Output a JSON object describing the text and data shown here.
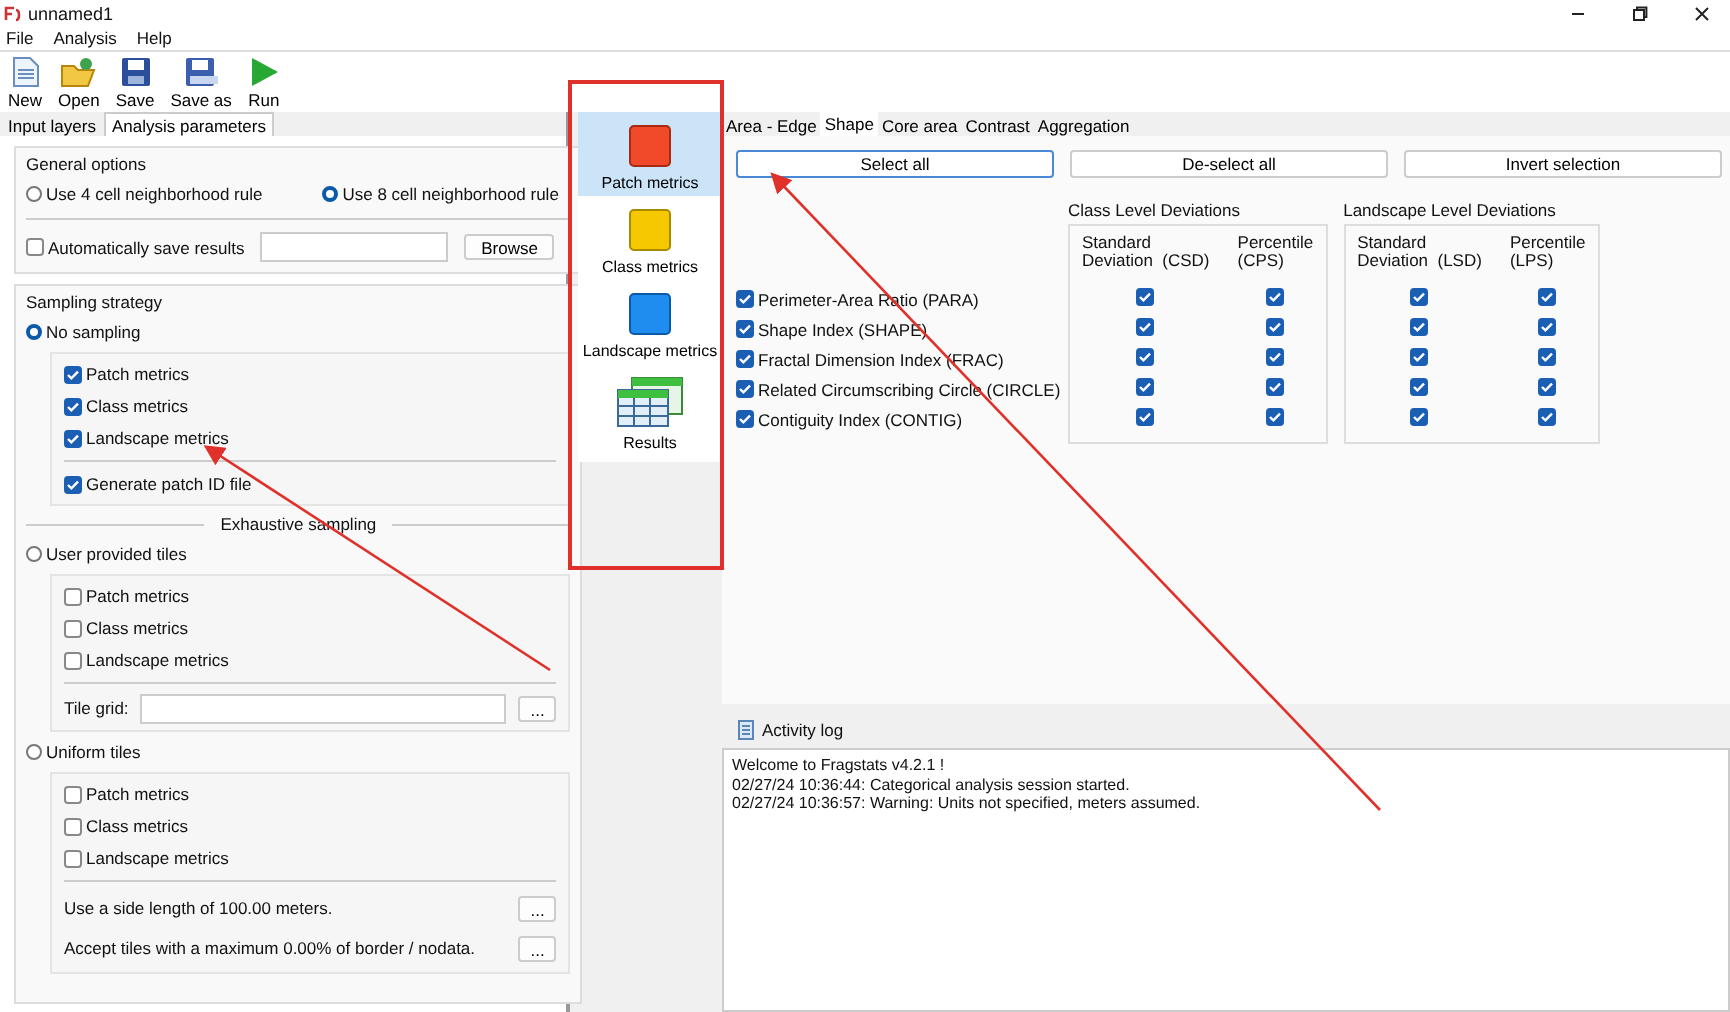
{
  "window": {
    "title": "unnamed1"
  },
  "menu": [
    "File",
    "Analysis",
    "Help"
  ],
  "toolbar": [
    {
      "label": "New",
      "kind": "new"
    },
    {
      "label": "Open",
      "kind": "open"
    },
    {
      "label": "Save",
      "kind": "save"
    },
    {
      "label": "Save as",
      "kind": "saveas"
    },
    {
      "label": "Run",
      "kind": "run"
    }
  ],
  "left_tabs": [
    {
      "label": "Input layers",
      "selected": false
    },
    {
      "label": "Analysis parameters",
      "selected": true
    }
  ],
  "general_options": {
    "title": "General options",
    "neighborhood": [
      {
        "label": "Use 4 cell neighborhood rule",
        "selected": false
      },
      {
        "label": "Use 8 cell neighborhood rule",
        "selected": true
      }
    ],
    "auto_save": {
      "label": "Automatically save results",
      "checked": false
    },
    "browse_button": "Browse"
  },
  "sampling": {
    "title": "Sampling strategy",
    "no_sampling": {
      "label": "No sampling",
      "selected": true,
      "metrics": [
        {
          "label": "Patch metrics",
          "checked": true
        },
        {
          "label": "Class metrics",
          "checked": true
        },
        {
          "label": "Landscape metrics",
          "checked": true
        }
      ],
      "patch_id": {
        "label": "Generate patch ID file",
        "checked": true
      }
    },
    "exhaustive_label": "Exhaustive sampling",
    "user_tiles": {
      "label": "User provided tiles",
      "selected": false,
      "metrics": [
        {
          "label": "Patch metrics",
          "checked": false
        },
        {
          "label": "Class metrics",
          "checked": false
        },
        {
          "label": "Landscape metrics",
          "checked": false
        }
      ],
      "tile_grid_label": "Tile grid:",
      "button": "..."
    },
    "uniform_tiles": {
      "label": "Uniform tiles",
      "selected": false,
      "metrics": [
        {
          "label": "Patch metrics",
          "checked": false
        },
        {
          "label": "Class metrics",
          "checked": false
        },
        {
          "label": "Landscape metrics",
          "checked": false
        }
      ],
      "settings": [
        {
          "text": "Use a side length of 100.00 meters.",
          "button": "..."
        },
        {
          "text": "Accept tiles with a maximum 0.00% of border / nodata.",
          "button": "..."
        }
      ]
    }
  },
  "metric_groups": [
    {
      "label": "Patch metrics",
      "kind": "patch",
      "selected": true
    },
    {
      "label": "Class metrics",
      "kind": "class",
      "selected": false
    },
    {
      "label": "Landscape metrics",
      "kind": "landscape",
      "selected": false
    },
    {
      "label": "Results",
      "kind": "results",
      "selected": false
    }
  ],
  "metric_tabs": [
    {
      "label": "Area - Edge",
      "selected": false
    },
    {
      "label": "Shape",
      "selected": true
    },
    {
      "label": "Core area",
      "selected": false
    },
    {
      "label": "Contrast",
      "selected": false
    },
    {
      "label": "Aggregation",
      "selected": false
    }
  ],
  "actions": [
    {
      "label": "Select all",
      "focused": true
    },
    {
      "label": "De-select all",
      "focused": false
    },
    {
      "label": "Invert selection",
      "focused": false
    }
  ],
  "class_deviations": {
    "title": "Class Level Deviations",
    "columns": [
      [
        "Standard",
        "Deviation  (CSD)"
      ],
      [
        "Percentile",
        "(CPS)"
      ]
    ]
  },
  "landscape_deviations": {
    "title": "Landscape Level Deviations",
    "columns": [
      [
        "Standard",
        "Deviation  (LSD)"
      ],
      [
        "Percentile",
        "(LPS)"
      ]
    ]
  },
  "metrics": [
    {
      "label": "Perimeter-Area Ratio  (PARA)",
      "checked": true,
      "csd": true,
      "cps": true,
      "lsd": true,
      "lps": true
    },
    {
      "label": "Shape Index  (SHAPE)",
      "checked": true,
      "csd": true,
      "cps": true,
      "lsd": true,
      "lps": true
    },
    {
      "label": "Fractal Dimension Index  (FRAC)",
      "checked": true,
      "csd": true,
      "cps": true,
      "lsd": true,
      "lps": true
    },
    {
      "label": "Related Circumscribing Circle  (CIRCLE)",
      "checked": true,
      "csd": true,
      "cps": true,
      "lsd": true,
      "lps": true
    },
    {
      "label": "Contiguity Index  (CONTIG)",
      "checked": true,
      "csd": true,
      "cps": true,
      "lsd": true,
      "lps": true
    }
  ],
  "activity_log": {
    "title": "Activity log",
    "lines": [
      "Welcome to Fragstats v4.2.1 !",
      "02/27/24 10:36:44: Categorical analysis session started.",
      "02/27/24 10:36:57: Warning: Units not specified, meters assumed."
    ]
  }
}
